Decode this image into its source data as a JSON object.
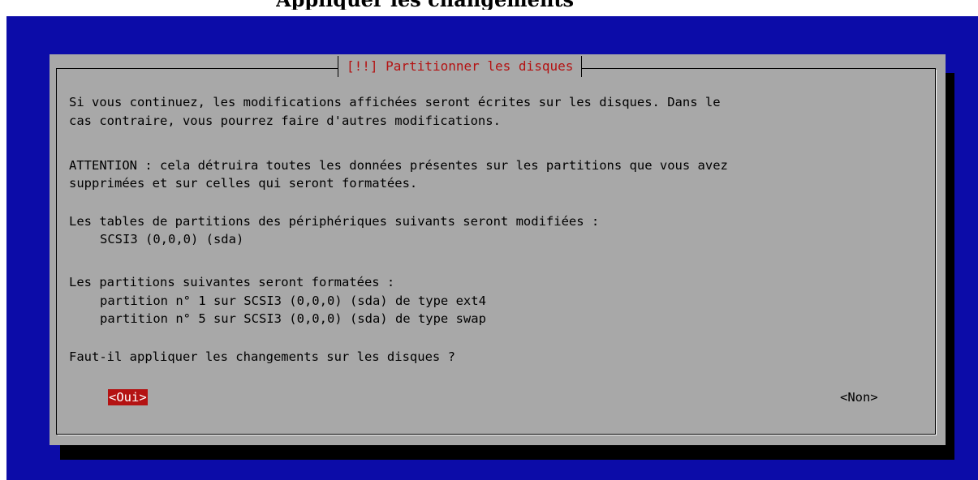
{
  "page": {
    "top_title": "Appliquer les changements"
  },
  "dialog": {
    "title": "[!!] Partitionner les disques",
    "lines": [
      "Si vous continuez, les modifications affichées seront écrites sur les disques. Dans le",
      "cas contraire, vous pourrez faire d'autres modifications.",
      "ATTENTION : cela détruira toutes les données présentes sur les partitions que vous avez",
      "supprimées et sur celles qui seront formatées.",
      "Les tables de partitions des périphériques suivants seront modifiées :",
      "SCSI3 (0,0,0) (sda)",
      "Les partitions suivantes seront formatées :",
      "partition n° 1 sur SCSI3 (0,0,0) (sda) de type ext4",
      "partition n° 5 sur SCSI3 (0,0,0) (sda) de type swap",
      "Faut-il appliquer les changements sur les disques ?"
    ],
    "buttons": {
      "yes": "<Oui>",
      "no": "<Non>"
    }
  },
  "colors": {
    "background": "#0c0ca8",
    "dialog": "#a8a8a8",
    "accent": "#b41212",
    "shadow": "#000000"
  }
}
